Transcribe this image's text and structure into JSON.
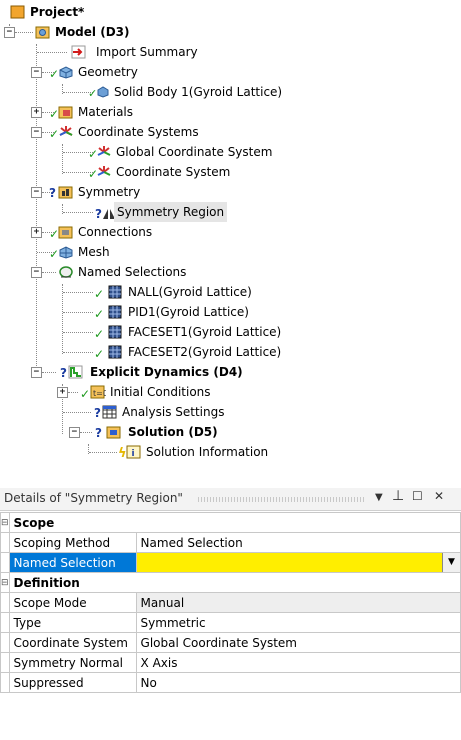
{
  "tree": {
    "project": "Project*",
    "model": "Model (D3)",
    "import_summary": "Import Summary",
    "geometry": "Geometry",
    "solid_body": "Solid Body 1(Gyroid Lattice)",
    "materials": "Materials",
    "coordinate_systems": "Coordinate Systems",
    "global_cs": "Global Coordinate System",
    "coordinate_system": "Coordinate System",
    "symmetry": "Symmetry",
    "symmetry_region": "Symmetry Region",
    "connections": "Connections",
    "mesh": "Mesh",
    "named_selections": "Named Selections",
    "nall": "NALL(Gyroid Lattice)",
    "pid1": "PID1(Gyroid Lattice)",
    "faceset1": "FACESET1(Gyroid Lattice)",
    "faceset2": "FACESET2(Gyroid Lattice)",
    "explicit": "Explicit Dynamics (D4)",
    "initial_conditions": "Initial Conditions",
    "analysis_settings": "Analysis Settings",
    "solution": "Solution (D5)",
    "solution_information": "Solution Information"
  },
  "details": {
    "title": "Details of \"Symmetry Region\"",
    "pin_icon": "pin-icon",
    "scope": "Scope",
    "scoping_method_key": "Scoping Method",
    "scoping_method_val": "Named Selection",
    "named_selection_key": "Named Selection",
    "named_selection_val": "",
    "definition": "Definition",
    "scope_mode_key": "Scope Mode",
    "scope_mode_val": "Manual",
    "type_key": "Type",
    "type_val": "Symmetric",
    "cs_key": "Coordinate System",
    "cs_val": "Global Coordinate System",
    "normal_key": "Symmetry Normal",
    "normal_val": "X Axis",
    "suppressed_key": "Suppressed",
    "suppressed_val": "No"
  },
  "colors": {
    "selected": "#0078d7",
    "required": "#ffee00",
    "check": "#1f9a1f"
  }
}
